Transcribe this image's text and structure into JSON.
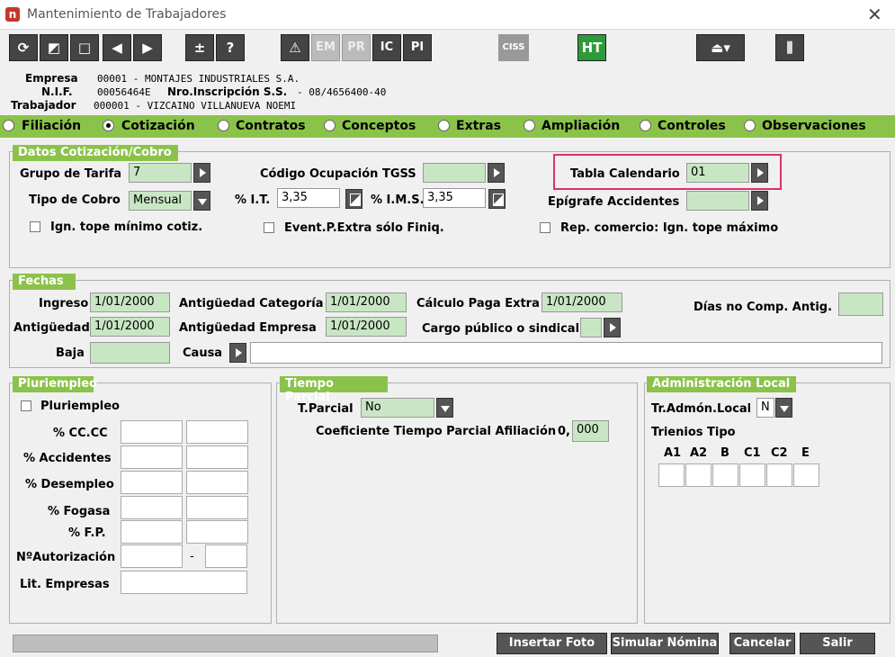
{
  "window": {
    "title": "Mantenimiento de Trabajadores",
    "close": "✕"
  },
  "toolbar": {
    "buttons": [
      {
        "name": "refresh-icon",
        "label": "⟳"
      },
      {
        "name": "edit-icon",
        "label": "◩"
      },
      {
        "name": "new-icon",
        "label": "□"
      },
      {
        "name": "prev-icon",
        "label": "◀"
      },
      {
        "name": "next-icon",
        "label": "▶"
      },
      {
        "name": "plusminus-icon",
        "label": "±"
      },
      {
        "name": "help-icon",
        "label": "?"
      },
      {
        "name": "alert-icon",
        "label": "⚠"
      },
      {
        "name": "em",
        "label": "EM"
      },
      {
        "name": "pr",
        "label": "PR"
      },
      {
        "name": "ic",
        "label": "IC"
      },
      {
        "name": "pi",
        "label": "PI"
      },
      {
        "name": "ciss",
        "label": "CISS"
      },
      {
        "name": "ht",
        "label": "HT"
      },
      {
        "name": "eject-icon",
        "label": "⏏▾"
      },
      {
        "name": "sliders-icon",
        "label": "⫼"
      }
    ]
  },
  "header": {
    "empresa_label": "Empresa",
    "empresa_value": "00001   - MONTAJES INDUSTRIALES S.A.",
    "nif_label": "N.I.F.",
    "nif_value": "00056464E",
    "nro_label": "Nro.Inscripción S.S.",
    "nro_value": "- 08/4656400-40",
    "trab_label": "Trabajador",
    "trab_value": "000001   - VIZCAINO VILLANUEVA NOEMI"
  },
  "tabs": [
    "Filiación",
    "Cotización",
    "Contratos",
    "Conceptos",
    "Extras",
    "Ampliación",
    "Controles",
    "Observaciones"
  ],
  "cotizacion": {
    "section": "Datos Cotización/Cobro",
    "grupo_label": "Grupo de Tarifa",
    "grupo_value": "7",
    "codigo_label": "Código Ocupación TGSS",
    "codigo_value": "",
    "tabla_label": "Tabla Calendario",
    "tabla_value": "01",
    "tipo_label": "Tipo de Cobro",
    "tipo_value": "Mensual",
    "it_label": "% I.T.",
    "it_value": "3,35",
    "ims_label": "% I.M.S.",
    "ims_value": "3,35",
    "epigrafe_label": "Epígrafe Accidentes",
    "epigrafe_value": "",
    "chk1": "Ign. tope mínimo cotiz.",
    "chk2": "Event.P.Extra sólo Finiq.",
    "chk3": "Rep. comercio: Ign. tope máximo"
  },
  "fechas": {
    "section": "Fechas",
    "ingreso_label": "Ingreso",
    "ingreso_value": "1/01/2000",
    "antcat_label": "Antigüedad Categoría",
    "antcat_value": "1/01/2000",
    "calc_label": "Cálculo Paga Extra",
    "calc_value": "1/01/2000",
    "dias_label": "Días no Comp. Antig.",
    "dias_value": "",
    "antig_label": "Antigüedad",
    "antig_value": "1/01/2000",
    "antemp_label": "Antigüedad Empresa",
    "antemp_value": "1/01/2000",
    "cargo_label": "Cargo público o sindical",
    "cargo_value": "",
    "baja_label": "Baja",
    "baja_value": "",
    "causa_label": "Causa",
    "causa_value": ""
  },
  "pluri": {
    "section": "Pluriempleo",
    "chk": "Pluriempleo",
    "rows": [
      "% CC.CC",
      "% Accidentes",
      "% Desempleo",
      "% Fogasa",
      "% F.P.",
      "NºAutorización",
      "Lit. Empresas"
    ],
    "dash": "-"
  },
  "parcial": {
    "section": "Tiempo Parcial",
    "tparcial_label": "T.Parcial",
    "tparcial_value": "No",
    "coef_label": "Coeficiente Tiempo Parcial Afiliación",
    "coef_prefix": "0,",
    "coef_value": "000"
  },
  "admin": {
    "section": "Administración Local",
    "tr_label": "Tr.Admón.Local",
    "tr_value": "N",
    "trienios_label": "Trienios Tipo",
    "cols": [
      "A1",
      "A2",
      "B",
      "C1",
      "C2",
      "E"
    ]
  },
  "footer": {
    "insertar": "Insertar Foto",
    "simular": "Simular Nómina",
    "cancelar": "Cancelar",
    "salir": "Salir"
  }
}
